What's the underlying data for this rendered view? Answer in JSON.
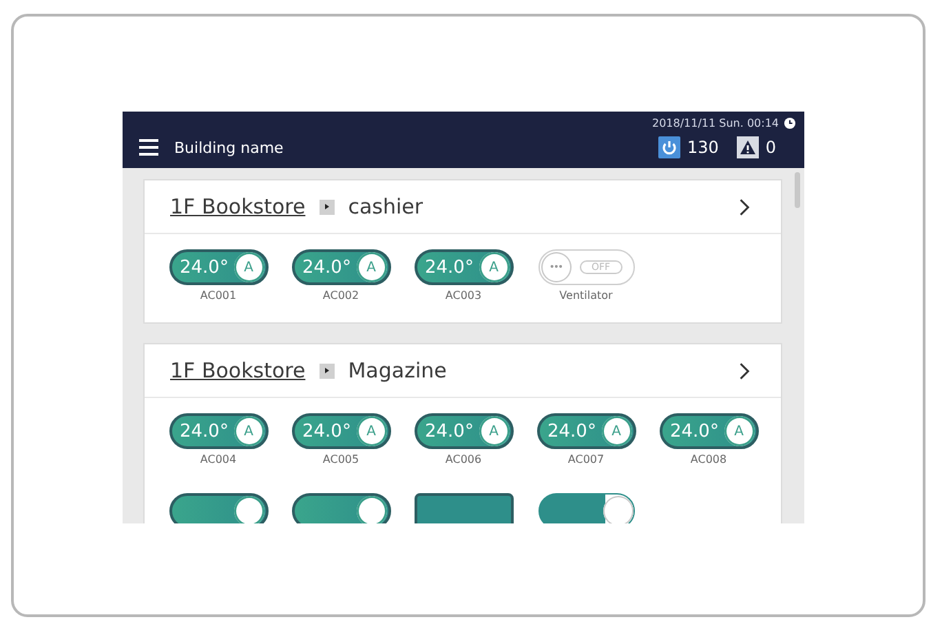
{
  "header": {
    "title": "Building name",
    "datetime": "2018/11/11 Sun. 00:14",
    "running_count": "130",
    "alarm_count": "0"
  },
  "groups": [
    {
      "floor": "1F Bookstore",
      "area": "cashier",
      "devices": [
        {
          "kind": "ac",
          "on": true,
          "temp": "24.0°",
          "mode": "A",
          "label": "AC001"
        },
        {
          "kind": "ac",
          "on": true,
          "temp": "24.0°",
          "mode": "A",
          "label": "AC002"
        },
        {
          "kind": "ac",
          "on": true,
          "temp": "24.0°",
          "mode": "A",
          "label": "AC003"
        },
        {
          "kind": "vent",
          "on": false,
          "dots": "•••",
          "state": "OFF",
          "label": "Ventilator"
        }
      ]
    },
    {
      "floor": "1F Bookstore",
      "area": "Magazine",
      "devices": [
        {
          "kind": "ac",
          "on": true,
          "temp": "24.0°",
          "mode": "A",
          "label": "AC004"
        },
        {
          "kind": "ac",
          "on": true,
          "temp": "24.0°",
          "mode": "A",
          "label": "AC005"
        },
        {
          "kind": "ac",
          "on": true,
          "temp": "24.0°",
          "mode": "A",
          "label": "AC006"
        },
        {
          "kind": "ac",
          "on": true,
          "temp": "24.0°",
          "mode": "A",
          "label": "AC007"
        },
        {
          "kind": "ac",
          "on": true,
          "temp": "24.0°",
          "mode": "A",
          "label": "AC008"
        },
        {
          "kind": "ac",
          "on": true
        },
        {
          "kind": "ac",
          "on": true
        },
        {
          "kind": "bar",
          "on": true
        },
        {
          "kind": "vent",
          "on": true
        }
      ]
    }
  ]
}
